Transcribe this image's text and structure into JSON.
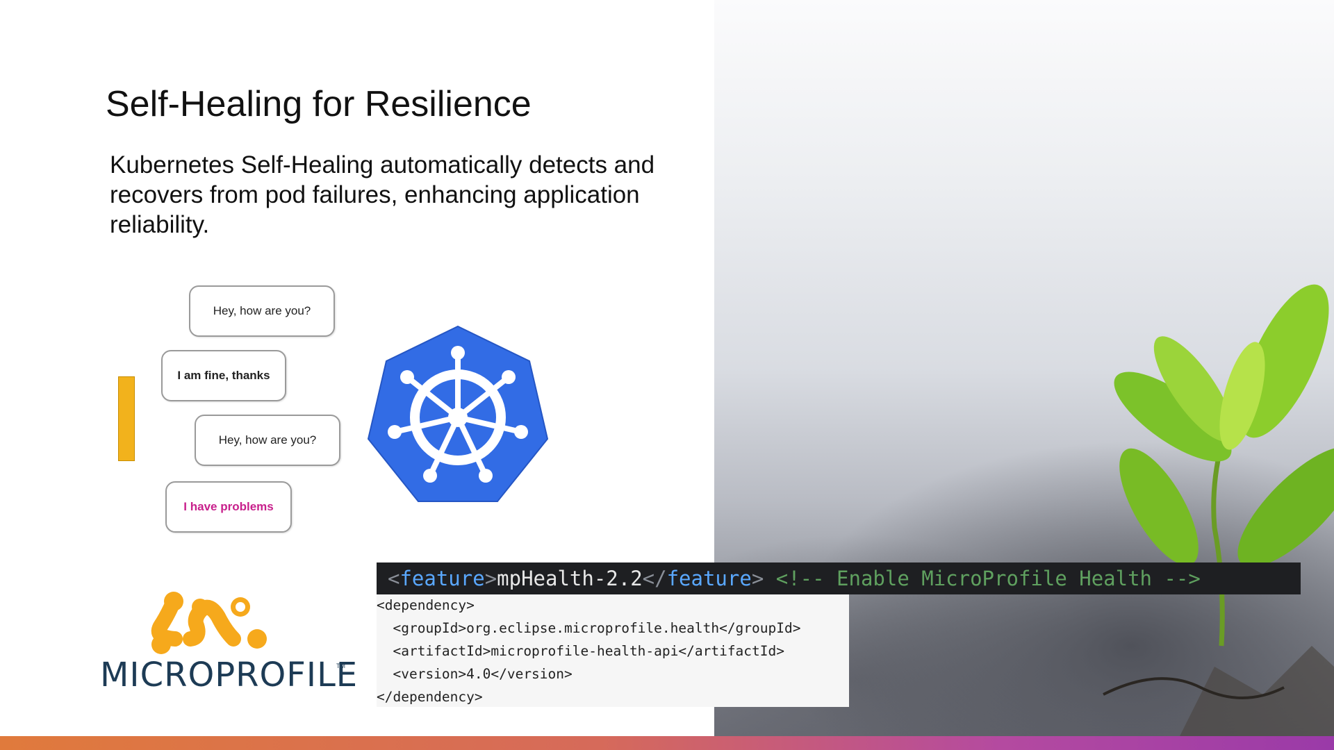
{
  "slide": {
    "title": "Self-Healing for Resilience",
    "body": "Kubernetes Self-Healing automatically detects and recovers from pod failures, enhancing application reliability."
  },
  "bubbles": [
    {
      "text": "Hey, how are you?"
    },
    {
      "text": "I am fine, thanks"
    },
    {
      "text": "Hey, how are you?"
    },
    {
      "text": "I have problems"
    }
  ],
  "code_feature": {
    "open_bracket": "<",
    "tag_open": "feature",
    "close_bracket": ">",
    "value": "mpHealth-2.2",
    "close_open_bracket": "</",
    "tag_close": "feature",
    "close_close_bracket": ">",
    "comment": "<!-- Enable MicroProfile Health -->"
  },
  "code_dependency": [
    "<dependency>",
    "  <groupId>org.eclipse.microprofile.health</groupId>",
    "  <artifactId>microprofile-health-api</artifactId>",
    "  <version>4.0</version>",
    "</dependency>"
  ],
  "logo": {
    "text": "MICROPROFILE",
    "tm": "TM"
  },
  "colors": {
    "kubernetes_blue": "#326ce5",
    "microprofile_orange": "#f6a91c",
    "pink": "#c8208c",
    "bar": "#f2b21c"
  }
}
